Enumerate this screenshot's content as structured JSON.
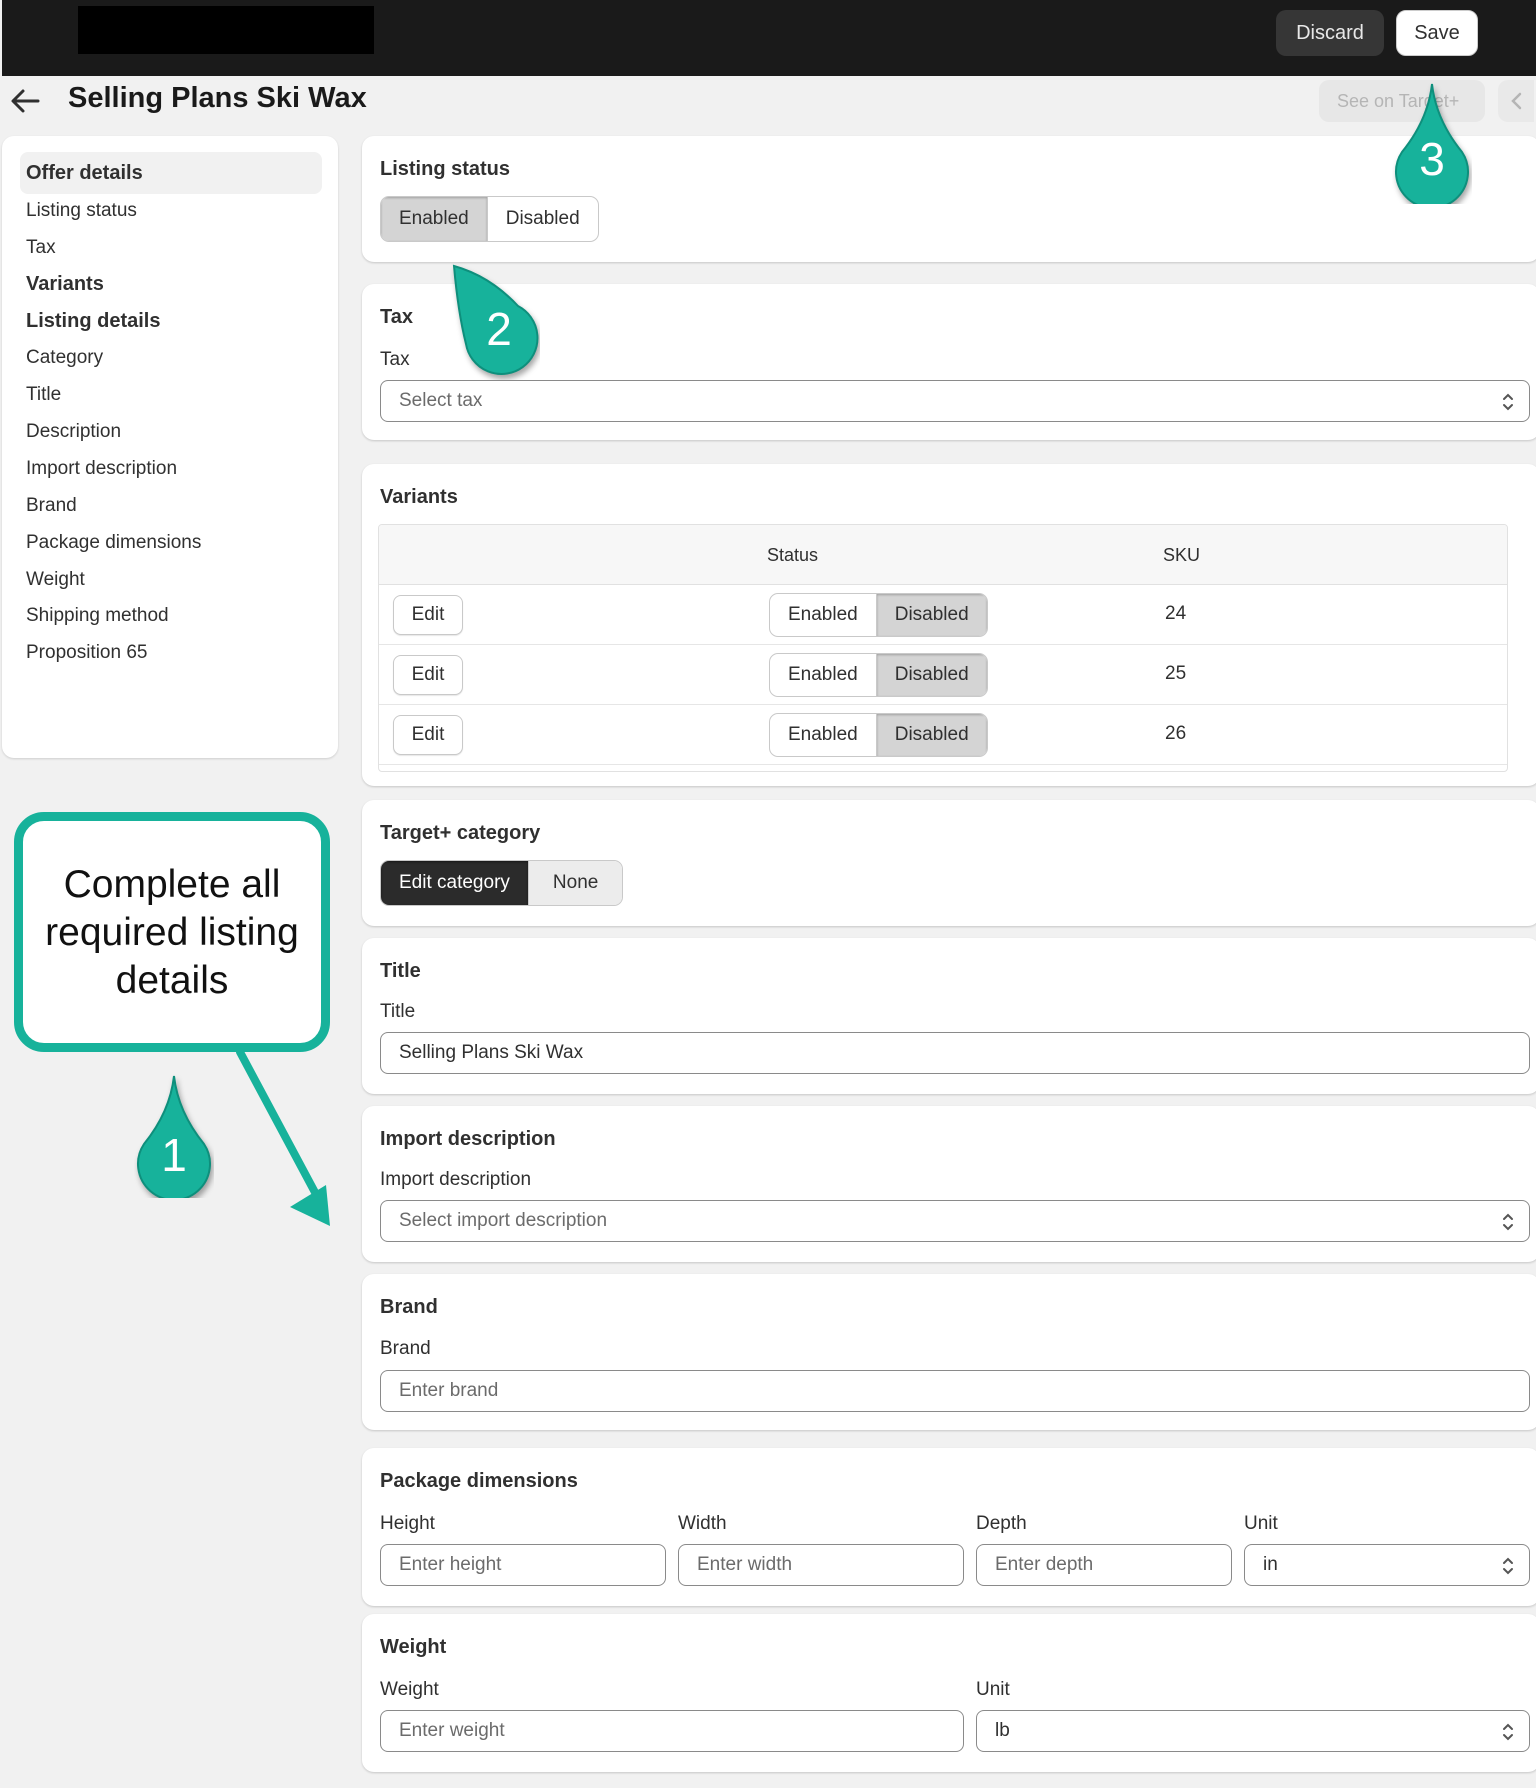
{
  "header": {
    "discard_label": "Discard",
    "save_label": "Save"
  },
  "page": {
    "title": "Selling Plans Ski Wax",
    "see_on_label": "See on Target+"
  },
  "sidebar": {
    "items": [
      {
        "label": "Offer details",
        "bold": true
      },
      {
        "label": "Listing status"
      },
      {
        "label": "Tax"
      },
      {
        "label": "Variants",
        "bold": true
      },
      {
        "label": "Listing details",
        "bold": true
      },
      {
        "label": "Category"
      },
      {
        "label": "Title"
      },
      {
        "label": "Description"
      },
      {
        "label": "Import description"
      },
      {
        "label": "Brand"
      },
      {
        "label": "Package dimensions"
      },
      {
        "label": "Weight"
      },
      {
        "label": "Shipping method"
      },
      {
        "label": "Proposition 65"
      }
    ]
  },
  "listing_status": {
    "title": "Listing status",
    "enabled_label": "Enabled",
    "disabled_label": "Disabled",
    "selected": "Enabled"
  },
  "tax": {
    "title": "Tax",
    "label": "Tax",
    "placeholder": "Select tax"
  },
  "variants": {
    "title": "Variants",
    "columns": {
      "status": "Status",
      "sku": "SKU"
    },
    "edit_label": "Edit",
    "enabled_label": "Enabled",
    "disabled_label": "Disabled",
    "rows": [
      {
        "sku": "24",
        "status": "Disabled"
      },
      {
        "sku": "25",
        "status": "Disabled"
      },
      {
        "sku": "26",
        "status": "Disabled"
      }
    ]
  },
  "category": {
    "title": "Target+ category",
    "edit_label": "Edit category",
    "none_label": "None"
  },
  "title_section": {
    "title": "Title",
    "label": "Title",
    "value": "Selling Plans Ski Wax"
  },
  "import_description": {
    "title": "Import description",
    "label": "Import description",
    "placeholder": "Select import description"
  },
  "brand": {
    "title": "Brand",
    "label": "Brand",
    "placeholder": "Enter brand"
  },
  "package_dimensions": {
    "title": "Package dimensions",
    "height_label": "Height",
    "height_placeholder": "Enter height",
    "width_label": "Width",
    "width_placeholder": "Enter width",
    "depth_label": "Depth",
    "depth_placeholder": "Enter depth",
    "unit_label": "Unit",
    "unit_value": "in"
  },
  "weight": {
    "title": "Weight",
    "label": "Weight",
    "placeholder": "Enter weight",
    "unit_label": "Unit",
    "unit_value": "lb"
  },
  "annotations": {
    "callout_lines": [
      "Complete all",
      "required listing",
      "details"
    ],
    "step1": "1",
    "step2": "2",
    "step3": "3",
    "accent": "#17b29b"
  }
}
